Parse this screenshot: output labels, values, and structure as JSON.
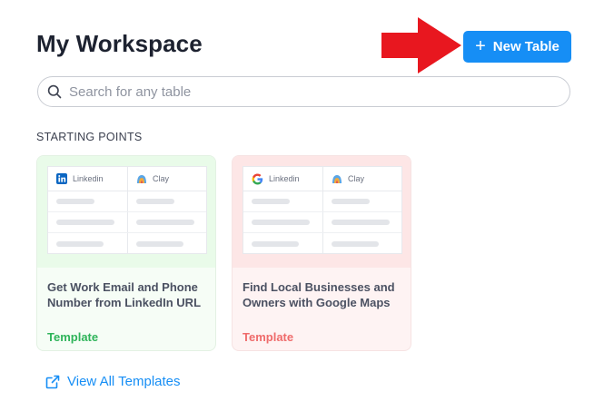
{
  "header": {
    "title": "My Workspace",
    "new_table_label": "New Table",
    "new_table_icon": "plus-icon"
  },
  "search": {
    "placeholder": "Search for any table",
    "value": ""
  },
  "starting_points": {
    "label": "STARTING POINTS",
    "cards": [
      {
        "title": "Get Work Email and Phone Number from LinkedIn URL",
        "tag": "Template",
        "columns": [
          {
            "label": "Linkedin",
            "icon": "linkedin-icon"
          },
          {
            "label": "Clay",
            "icon": "clay-icon"
          }
        ],
        "accent": "#2fb45a"
      },
      {
        "title": "Find Local Businesses and Owners with Google Maps",
        "tag": "Template",
        "columns": [
          {
            "label": "Linkedin",
            "icon": "google-icon"
          },
          {
            "label": "Clay",
            "icon": "clay-icon"
          }
        ],
        "accent": "#ef6b6b"
      }
    ]
  },
  "view_all": {
    "label": "View All Templates",
    "icon": "external-link-icon"
  },
  "colors": {
    "primary": "#168ef5",
    "annotation_arrow": "#e8171f"
  }
}
